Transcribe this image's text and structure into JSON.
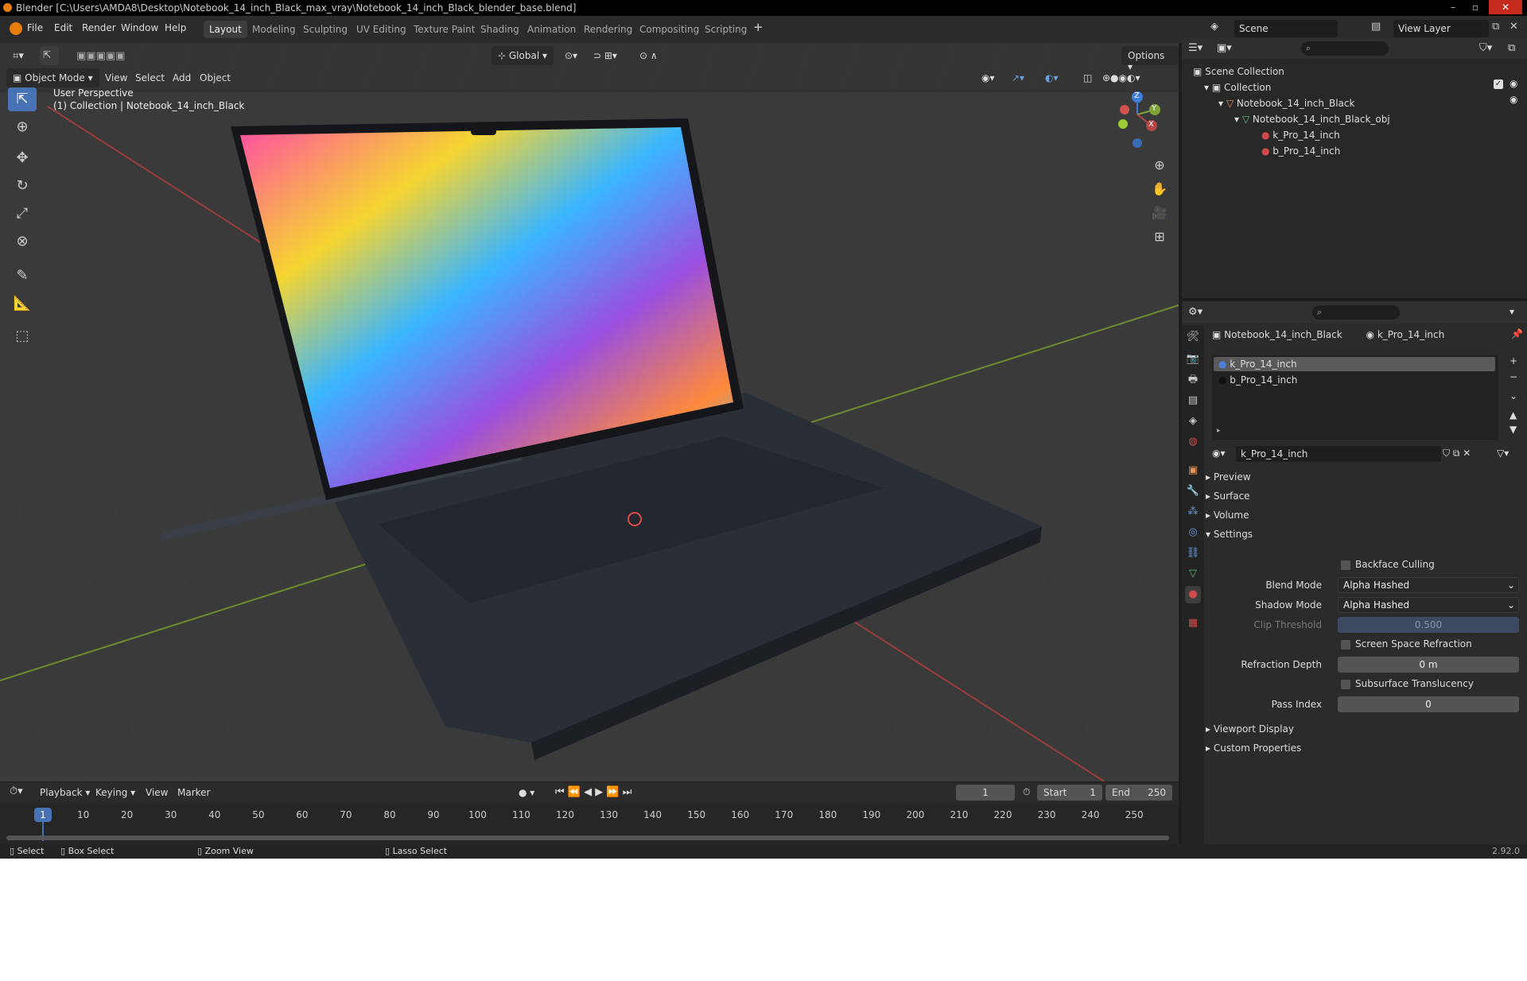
{
  "window": {
    "title": "Blender [C:\\Users\\AMDA8\\Desktop\\Notebook_14_inch_Black_max_vray\\Notebook_14_inch_Black_blender_base.blend]"
  },
  "menu": [
    "File",
    "Edit",
    "Render",
    "Window",
    "Help"
  ],
  "workspaces": [
    "Layout",
    "Modeling",
    "Sculpting",
    "UV Editing",
    "Texture Paint",
    "Shading",
    "Animation",
    "Rendering",
    "Compositing",
    "Scripting"
  ],
  "active_workspace": "Layout",
  "scene": "Scene",
  "view_layer": "View Layer",
  "viewport": {
    "mode": "Object Mode",
    "menu": [
      "View",
      "Select",
      "Add",
      "Object"
    ],
    "orientation": "Global",
    "options": "Options",
    "perspective": "User Perspective",
    "collection_label": "(1) Collection | Notebook_14_inch_Black",
    "gizmo": {
      "x": "X",
      "y": "Y",
      "z": "Z"
    }
  },
  "outliner": {
    "rows": [
      "Scene Collection",
      "Collection",
      "Notebook_14_inch_Black",
      "Notebook_14_inch_Black_obj",
      "k_Pro_14_inch",
      "b_Pro_14_inch"
    ]
  },
  "properties": {
    "object": "Notebook_14_inch_Black",
    "material": "k_Pro_14_inch",
    "slots": [
      "k_Pro_14_inch",
      "b_Pro_14_inch"
    ],
    "material_field": "k_Pro_14_inch",
    "panels": [
      "Preview",
      "Surface",
      "Volume",
      "Settings"
    ],
    "settings": {
      "backface": "Backface Culling",
      "blend_label": "Blend Mode",
      "blend_value": "Alpha Hashed",
      "shadow_label": "Shadow Mode",
      "shadow_value": "Alpha Hashed",
      "clip_label": "Clip Threshold",
      "clip_value": "0.500",
      "ssr": "Screen Space Refraction",
      "depth_label": "Refraction Depth",
      "depth_value": "0 m",
      "sst": "Subsurface Translucency",
      "pass_label": "Pass Index",
      "pass_value": "0"
    },
    "bottom_panels": [
      "Viewport Display",
      "Custom Properties"
    ]
  },
  "timeline": {
    "menu": [
      "Playback",
      "Keying",
      "View",
      "Marker"
    ],
    "current": "1",
    "start_label": "Start",
    "start": "1",
    "end_label": "End",
    "end": "250",
    "ticks": [
      "10",
      "20",
      "30",
      "40",
      "50",
      "60",
      "70",
      "80",
      "90",
      "100",
      "110",
      "120",
      "130",
      "140",
      "150",
      "160",
      "170",
      "180",
      "190",
      "200",
      "210",
      "220",
      "230",
      "240",
      "250"
    ]
  },
  "status": {
    "select": "Select",
    "box": "Box Select",
    "zoom": "Zoom View",
    "lasso": "Lasso Select",
    "version": "2.92.0"
  },
  "colors": {
    "accent": "#4772b3",
    "x_axis": "#b54545",
    "y_axis": "#7ea33a",
    "z_axis": "#3d7edb"
  }
}
